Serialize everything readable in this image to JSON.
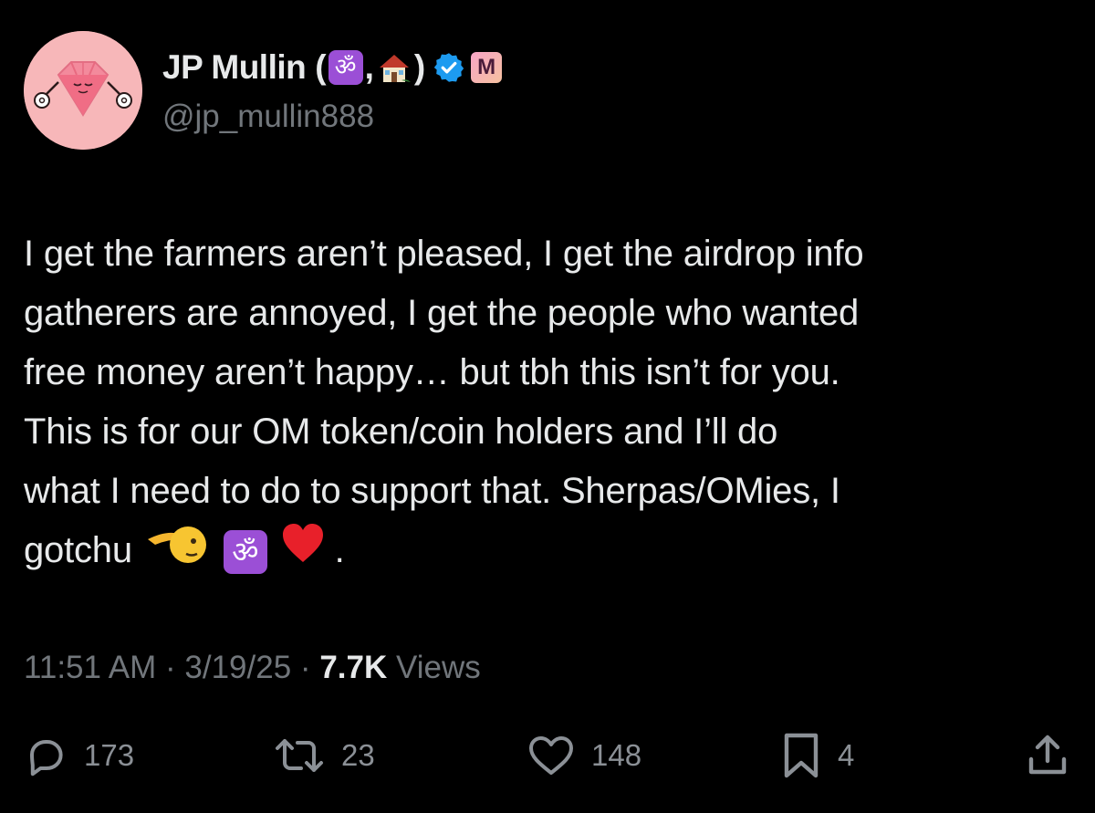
{
  "colors": {
    "background": "#000000",
    "text_primary": "#e7e9ea",
    "text_secondary": "#71767b",
    "verified_blue": "#1d9bf0",
    "om_purple": "#9b4fd6"
  },
  "author": {
    "display_name": "JP Mullin",
    "open_paren": "(",
    "name_emoji_1": "ॐ",
    "name_separator": ",",
    "name_emoji_2": "house-emoji",
    "close_paren": ")",
    "verified_icon": "verified-badge-icon",
    "affiliate_badge": "M",
    "handle": "@jp_mullin888",
    "avatar_icon": "pink-diamond-avatar"
  },
  "tweet": {
    "lines": [
      "I get the farmers aren’t pleased, I get the airdrop info",
      "gatherers are annoyed, I get the people who wanted",
      "free money aren’t happy… but tbh this isn’t for you.",
      "This is for our OM token/coin holders and I’ll do",
      "what I need to do to support that. Sherpas/OMies, I",
      "gotchu"
    ],
    "trailing_emoji_1": "saluting-hand-emoji",
    "trailing_emoji_2": "ॐ",
    "trailing_emoji_3": "red-heart-emoji",
    "trailing_period": "."
  },
  "meta": {
    "time": "11:51 AM",
    "dot1": "·",
    "date": "3/19/25",
    "dot2": "·",
    "views_count": "7.7K",
    "views_label": "Views"
  },
  "actions": {
    "replies": "173",
    "reposts": "23",
    "likes": "148",
    "bookmarks": "4"
  }
}
